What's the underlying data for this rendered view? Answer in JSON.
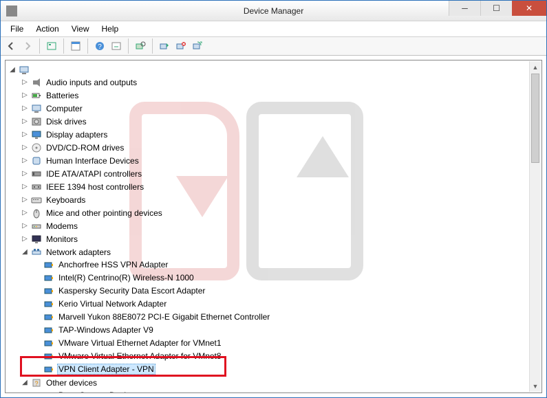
{
  "window": {
    "title": "Device Manager"
  },
  "menubar": {
    "file": "File",
    "action": "Action",
    "view": "View",
    "help": "Help"
  },
  "toolbar_icons": [
    "back",
    "forward",
    "show-hidden",
    "properties",
    "help",
    "update",
    "scan",
    "uninstall",
    "disable",
    "enable",
    "legacy"
  ],
  "tree": {
    "root_icon": "computer-root",
    "categories": [
      {
        "label": "Audio inputs and outputs",
        "icon": "audio-icon",
        "expanded": false
      },
      {
        "label": "Batteries",
        "icon": "battery-icon",
        "expanded": false
      },
      {
        "label": "Computer",
        "icon": "computer-icon",
        "expanded": false
      },
      {
        "label": "Disk drives",
        "icon": "disk-icon",
        "expanded": false
      },
      {
        "label": "Display adapters",
        "icon": "display-icon",
        "expanded": false
      },
      {
        "label": "DVD/CD-ROM drives",
        "icon": "dvd-icon",
        "expanded": false
      },
      {
        "label": "Human Interface Devices",
        "icon": "hid-icon",
        "expanded": false
      },
      {
        "label": "IDE ATA/ATAPI controllers",
        "icon": "ide-icon",
        "expanded": false
      },
      {
        "label": "IEEE 1394 host controllers",
        "icon": "ieee1394-icon",
        "expanded": false
      },
      {
        "label": "Keyboards",
        "icon": "keyboard-icon",
        "expanded": false
      },
      {
        "label": "Mice and other pointing devices",
        "icon": "mouse-icon",
        "expanded": false
      },
      {
        "label": "Modems",
        "icon": "modem-icon",
        "expanded": false
      },
      {
        "label": "Monitors",
        "icon": "monitor-icon",
        "expanded": false
      },
      {
        "label": "Network adapters",
        "icon": "network-icon",
        "expanded": true,
        "children": [
          {
            "label": "Anchorfree HSS VPN Adapter",
            "icon": "nic-icon"
          },
          {
            "label": "Intel(R) Centrino(R) Wireless-N 1000",
            "icon": "nic-icon"
          },
          {
            "label": "Kaspersky Security Data Escort Adapter",
            "icon": "nic-icon"
          },
          {
            "label": "Kerio Virtual Network Adapter",
            "icon": "nic-icon"
          },
          {
            "label": "Marvell Yukon 88E8072 PCI-E Gigabit Ethernet Controller",
            "icon": "nic-icon"
          },
          {
            "label": "TAP-Windows Adapter V9",
            "icon": "nic-icon"
          },
          {
            "label": "VMware Virtual Ethernet Adapter for VMnet1",
            "icon": "nic-icon"
          },
          {
            "label": "VMware Virtual Ethernet Adapter for VMnet8",
            "icon": "nic-icon"
          },
          {
            "label": "VPN Client Adapter - VPN",
            "icon": "nic-icon",
            "selected": true
          }
        ]
      },
      {
        "label": "Other devices",
        "icon": "other-icon",
        "expanded": true,
        "children": [
          {
            "label": "Base System Device",
            "icon": "unknown-icon",
            "warning": true
          }
        ]
      }
    ]
  }
}
